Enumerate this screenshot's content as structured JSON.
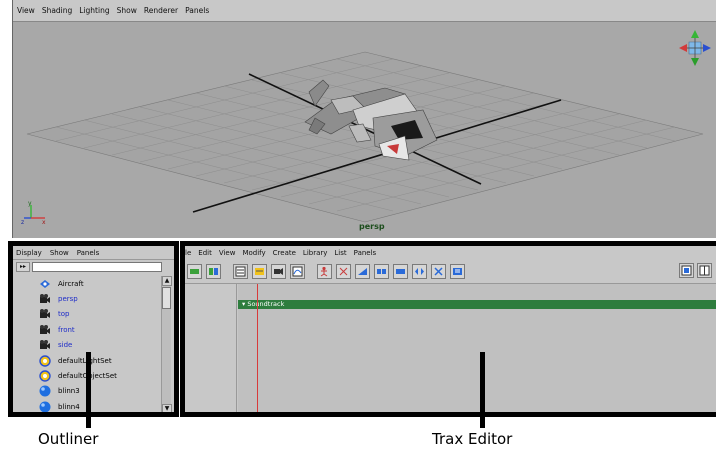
{
  "viewport": {
    "menu": [
      "View",
      "Shading",
      "Lighting",
      "Show",
      "Renderer",
      "Panels"
    ],
    "camera_label": "persp",
    "axis_labels": {
      "x": "x",
      "y": "y",
      "z": "z"
    }
  },
  "outliner": {
    "menu": [
      "Display",
      "Show",
      "Panels"
    ],
    "filter_buttons": [
      "▸▸",
      "▸▸"
    ],
    "items": [
      {
        "label": "Aircraft",
        "icon": "transform-icon",
        "color": "#000000"
      },
      {
        "label": "persp",
        "icon": "camera-icon",
        "color": "#1e2cc8"
      },
      {
        "label": "top",
        "icon": "camera-icon",
        "color": "#1e2cc8"
      },
      {
        "label": "front",
        "icon": "camera-icon",
        "color": "#1e2cc8"
      },
      {
        "label": "side",
        "icon": "camera-icon",
        "color": "#1e2cc8"
      },
      {
        "label": "defaultLightSet",
        "icon": "set-icon",
        "color": "#000000"
      },
      {
        "label": "defaultObjectSet",
        "icon": "set-icon",
        "color": "#000000"
      },
      {
        "label": "blinn3",
        "icon": "shader-sphere-icon",
        "color": "#000000"
      },
      {
        "label": "blinn4",
        "icon": "shader-sphere-icon",
        "color": "#000000"
      }
    ],
    "scroll_up": "▲",
    "scroll_down": "▼"
  },
  "trax": {
    "menu": [
      "le",
      "Edit",
      "View",
      "Modify",
      "Create",
      "Library",
      "List",
      "Panels"
    ],
    "soundtrack_label": "▾ Soundtrack",
    "colors": {
      "soundtrack": "#2e7d3e",
      "time_marker": "#d83a3a"
    }
  },
  "captions": {
    "outliner": "Outliner",
    "trax": "Trax Editor"
  }
}
